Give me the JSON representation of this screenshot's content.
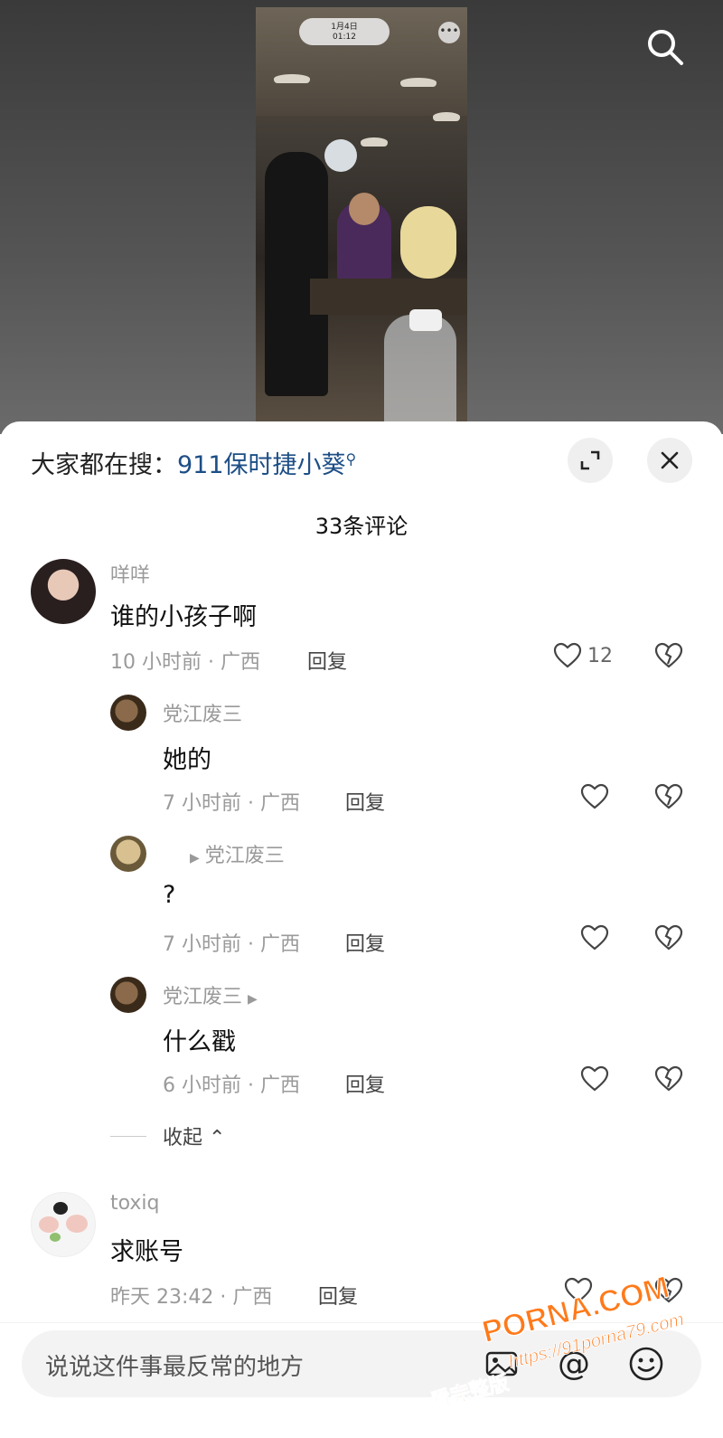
{
  "video": {
    "date": "1月4日",
    "time": "01:12"
  },
  "top_icons": {
    "search": "search-icon"
  },
  "sheet": {
    "search_prefix": "大家都在搜：",
    "search_keyword": "911保时捷小葵",
    "search_keyword_icon": "search-icon",
    "expand_icon": "expand-icon",
    "close_icon": "close-icon",
    "comment_count": "33条评论"
  },
  "comments": [
    {
      "user": "咩咩",
      "text": "谁的小孩子啊",
      "time": "10 小时前 · 广西",
      "reply": "回复",
      "likes": "12"
    },
    {
      "user": "党江废三",
      "text": "她的",
      "time": "7 小时前 · 广西",
      "reply": "回复"
    },
    {
      "reply_to": "党江废三",
      "text": "?",
      "time": "7 小时前 · 广西",
      "reply": "回复"
    },
    {
      "user": "党江废三",
      "text": "什么戳",
      "time": "6 小时前 · 广西",
      "reply": "回复"
    },
    {
      "user": "toxiq",
      "text": "求账号",
      "time": "昨天 23:42 · 广西",
      "reply": "回复"
    }
  ],
  "collapse_label": "收起",
  "input": {
    "placeholder": "说说这件事最反常的地方",
    "icons": [
      "image-icon",
      "at-icon",
      "emoji-icon"
    ],
    "at_symbol": "@"
  },
  "watermark": {
    "brand": "PORNA.COM",
    "url": "https://91porna79.com",
    "tag": "看完整版"
  },
  "colors": {
    "keyword": "#1d4e86",
    "watermark": "#ff7a1a"
  }
}
